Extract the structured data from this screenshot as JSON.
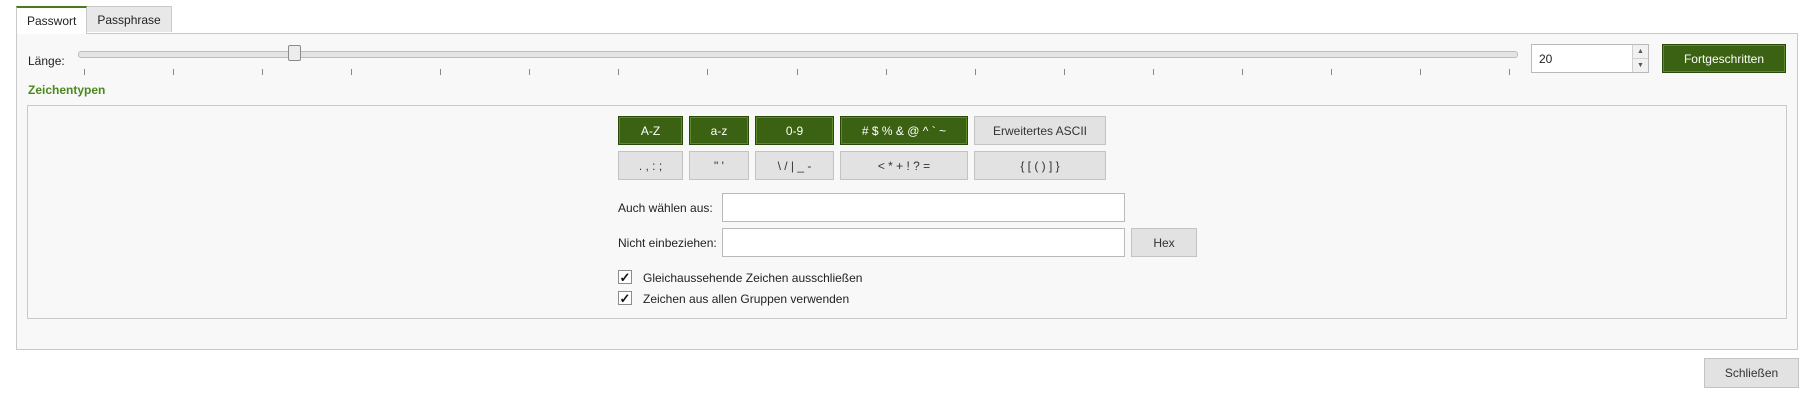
{
  "tabs": [
    {
      "label": "Passwort",
      "active": true
    },
    {
      "label": "Passphrase",
      "active": false
    }
  ],
  "length": {
    "label": "Länge:",
    "value": "20",
    "slider_fraction": 0.15
  },
  "advanced_button": "Fortgeschritten",
  "charset_section_title": "Zeichentypen",
  "char_groups_row1": [
    {
      "label": "A-Z",
      "selected": true
    },
    {
      "label": "a-z",
      "selected": true
    },
    {
      "label": "0-9",
      "selected": true
    },
    {
      "label": "# $ % & @ ^ ` ~",
      "selected": true
    },
    {
      "label": "Erweitertes ASCII",
      "selected": false
    }
  ],
  "char_groups_row2": [
    {
      "label": ". , : ;",
      "selected": false
    },
    {
      "label": "\" '",
      "selected": false
    },
    {
      "label": "\\ / | _ -",
      "selected": false
    },
    {
      "label": "< * + ! ? =",
      "selected": false
    },
    {
      "label": "{ [ ( ) ] }",
      "selected": false
    }
  ],
  "also_choose": {
    "label": "Auch wählen aus:",
    "value": ""
  },
  "exclude": {
    "label": "Nicht einbeziehen:",
    "value": "",
    "hex_button": "Hex"
  },
  "options": [
    {
      "label": "Gleichaussehende Zeichen ausschließen",
      "checked": true
    },
    {
      "label": "Zeichen aus allen Gruppen verwenden",
      "checked": true
    }
  ],
  "close_button": "Schließen",
  "colors": {
    "accent_green": "#3b6212",
    "section_title_green": "#4a8a1c"
  }
}
